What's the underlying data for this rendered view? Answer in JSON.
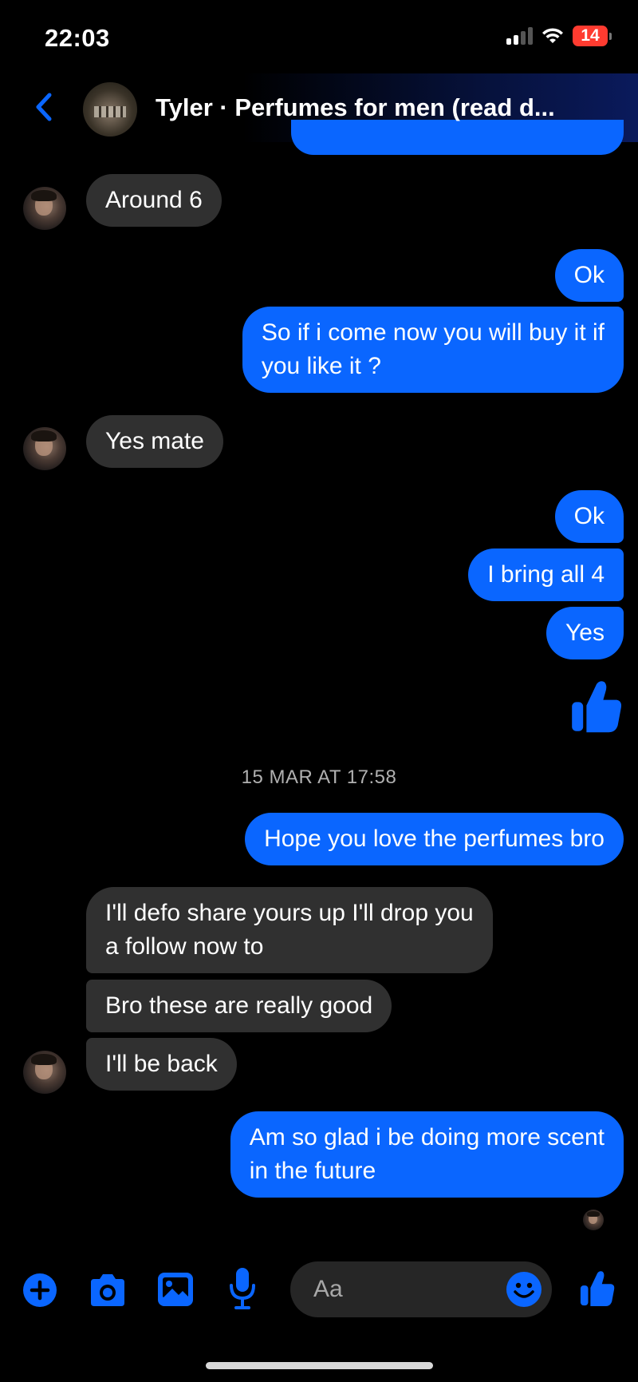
{
  "status_bar": {
    "time": "22:03",
    "battery": "14"
  },
  "header": {
    "title": "Tyler · Perfumes for men (read d..."
  },
  "messages": {
    "m1": "Around 6",
    "m2": "Ok",
    "m3_l1": "So if i come now you will buy it if",
    "m3_l2": "you like it ?",
    "m4": "Yes mate",
    "m5": "Ok",
    "m6": "I bring all 4",
    "m7": "Yes",
    "timestamp": "15 MAR AT 17:58",
    "m8": "Hope you love the perfumes bro",
    "m9_l1": "I'll defo share yours up I'll drop you",
    "m9_l2": "a follow now to",
    "m10": "Bro these are really good",
    "m11": "I'll be back",
    "m12_l1": "Am so glad i be doing more scent",
    "m12_l2": "in the future"
  },
  "composer": {
    "placeholder": "Aa"
  },
  "colors": {
    "accent": "#0a66ff",
    "incoming_bubble": "#303030",
    "background": "#000000"
  }
}
